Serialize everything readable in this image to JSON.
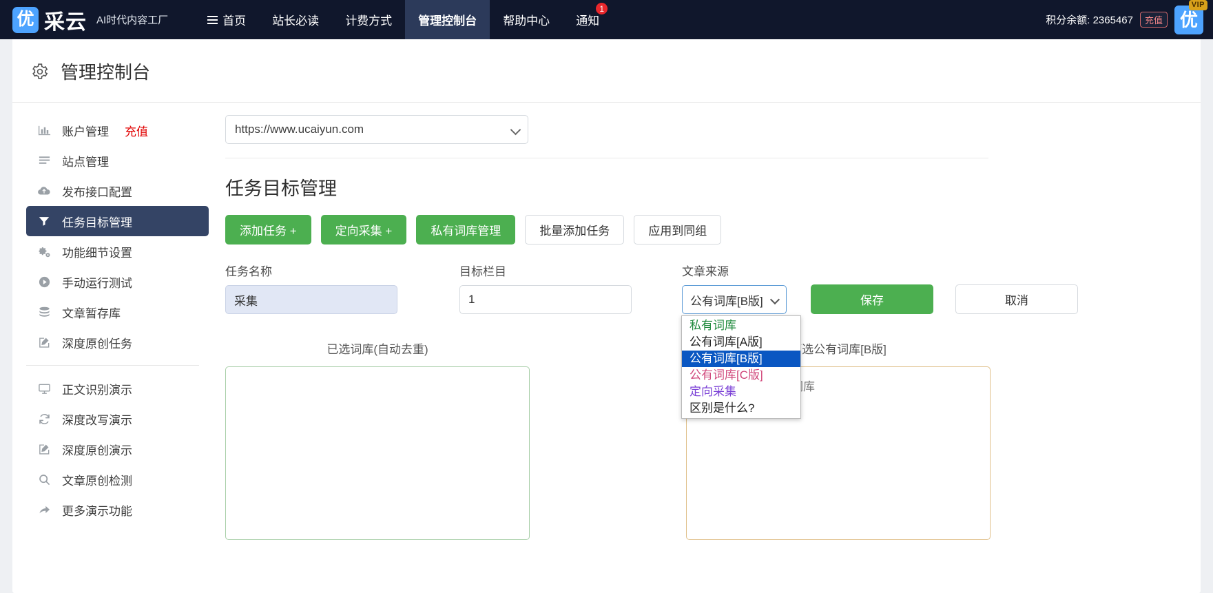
{
  "topnav": {
    "brand_mark": "优",
    "brand_word": "采云",
    "brand_tagline": "AI时代内容工厂",
    "items": [
      {
        "label": "首页",
        "icon": "hamburger-icon",
        "active": false,
        "badge": ""
      },
      {
        "label": "站长必读",
        "icon": "",
        "active": false,
        "badge": ""
      },
      {
        "label": "计费方式",
        "icon": "",
        "active": false,
        "badge": ""
      },
      {
        "label": "管理控制台",
        "icon": "",
        "active": true,
        "badge": ""
      },
      {
        "label": "帮助中心",
        "icon": "",
        "active": false,
        "badge": ""
      },
      {
        "label": "通知",
        "icon": "",
        "active": false,
        "badge": "1"
      }
    ],
    "credits_label": "积分余额: 2365467",
    "recharge_label": "充值",
    "vip_label": "VIP",
    "avatar_letter": "优",
    "colors": {
      "nav_bg": "#10172c",
      "nav_active_bg": "#2c3a5a",
      "brand_blue": "#4da3ff",
      "badge_red": "#e8272c",
      "vip_gold": "#d9a21b"
    }
  },
  "page": {
    "title": "管理控制台",
    "title_icon": "gear-icon"
  },
  "sidebar": {
    "items": [
      {
        "label": "账户管理",
        "extra": "充值",
        "icon": "bar-chart-icon",
        "active": false
      },
      {
        "label": "站点管理",
        "extra": "",
        "icon": "list-icon",
        "active": false
      },
      {
        "label": "发布接口配置",
        "extra": "",
        "icon": "cloud-upload-icon",
        "active": false
      },
      {
        "label": "任务目标管理",
        "extra": "",
        "icon": "filter-icon",
        "active": true
      },
      {
        "label": "功能细节设置",
        "extra": "",
        "icon": "gears-icon",
        "active": false
      },
      {
        "label": "手动运行测试",
        "extra": "",
        "icon": "play-circle-icon",
        "active": false
      },
      {
        "label": "文章暂存库",
        "extra": "",
        "icon": "database-icon",
        "active": false
      },
      {
        "label": "深度原创任务",
        "extra": "",
        "icon": "edit-square-icon",
        "active": false
      }
    ],
    "items2": [
      {
        "label": "正文识别演示",
        "extra": "",
        "icon": "desktop-icon",
        "active": false
      },
      {
        "label": "深度改写演示",
        "extra": "",
        "icon": "refresh-icon",
        "active": false
      },
      {
        "label": "深度原创演示",
        "extra": "",
        "icon": "edit-square-icon",
        "active": false
      },
      {
        "label": "文章原创检测",
        "extra": "",
        "icon": "search-icon",
        "active": false
      },
      {
        "label": "更多演示功能",
        "extra": "",
        "icon": "arrow-forward-icon",
        "active": false
      }
    ],
    "active_bg": "#344465",
    "extra_color": "#e10000"
  },
  "main": {
    "site_select_value": "https://www.ucaiyun.com",
    "section_title": "任务目标管理",
    "buttons": [
      {
        "label": "添加任务 +",
        "style": "green"
      },
      {
        "label": "定向采集 +",
        "style": "green"
      },
      {
        "label": "私有词库管理",
        "style": "green"
      },
      {
        "label": "批量添加任务",
        "style": "outline"
      },
      {
        "label": "应用到同组",
        "style": "outline"
      }
    ],
    "form": {
      "task_name_label": "任务名称",
      "task_name_value": "采集",
      "target_column_label": "目标栏目",
      "target_column_value": "1",
      "source_label": "文章来源",
      "source_value": "公有词库[B版]",
      "save_label": "保存",
      "cancel_label": "取消"
    },
    "dropdown": {
      "open": true,
      "options": [
        {
          "label": "私有词库",
          "color": "#1f8a3c",
          "selected": false
        },
        {
          "label": "公有词库[A版]",
          "color": "#222222",
          "selected": false
        },
        {
          "label": "公有词库[B版]",
          "color": "#ffffff",
          "selected": true
        },
        {
          "label": "公有词库[C版]",
          "color": "#d0467a",
          "selected": false
        },
        {
          "label": "定向采集",
          "color": "#7a3fd6",
          "selected": false
        },
        {
          "label": "区别是什么?",
          "color": "#222222",
          "selected": false
        }
      ],
      "selected_bg": "#0a57c2"
    },
    "panels": {
      "left": {
        "title": "已选词库(自动去重)",
        "border_color": "#a8cfa8",
        "content": ""
      },
      "right": {
        "title": "可选公有词库[B版]",
        "border_color": "#e0c08a",
        "content": "下面的搜索框查找词库"
      }
    }
  }
}
